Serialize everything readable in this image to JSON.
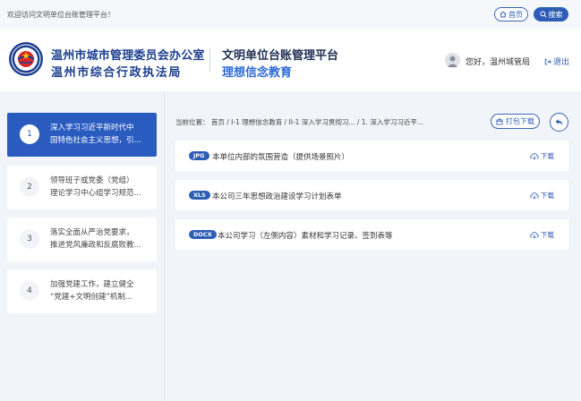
{
  "topbar": {
    "welcome": "欢迎访问文明单位台账管理平台！",
    "home_label": "首页",
    "search_label": "搜索"
  },
  "header": {
    "org_name_1": "温州市城市管理委员会办公室",
    "org_name_2": "温州市综合行政执法局",
    "platform_title": "文明单位台账管理平台",
    "platform_sub": "理想信念教育",
    "greeting": "您好，温州城管局",
    "logout": "退出"
  },
  "sidebar": {
    "items": [
      {
        "num": "1",
        "line1": "深入学习习近平新时代中",
        "line2": "国特色社会主义思想，引..."
      },
      {
        "num": "2",
        "line1": "领导班子或党委（党组）",
        "line2": "理论学习中心组学习规范..."
      },
      {
        "num": "3",
        "line1": "落实全面从严治党要求，",
        "line2": "推进党风廉政和反腐败教..."
      },
      {
        "num": "4",
        "line1": "加强党建工作，建立健全",
        "line2": "“党建+文明创建”机制..."
      }
    ]
  },
  "main": {
    "breadcrumb": "当前位置：  首页 / I-1 理想信念教育 / II-1 深入学习贯彻习... / 1. 深入学习习近平...",
    "pack_download": "打包下载",
    "download_label": "下载",
    "files": [
      {
        "type": "JPG",
        "name": "本单位内部的氛围营造（提供场景照片）"
      },
      {
        "type": "XLS",
        "name": "本公司三年思想政治建设学习计划表单"
      },
      {
        "type": "DOCX",
        "name": "本公司学习（左侧内容）素材和学习记录、签到表等"
      }
    ]
  },
  "colors": {
    "accent": "#2e5db8",
    "title_blue": "#1d3f8f",
    "sub_blue": "#2c6bd6",
    "background": "#f1f4f9"
  }
}
